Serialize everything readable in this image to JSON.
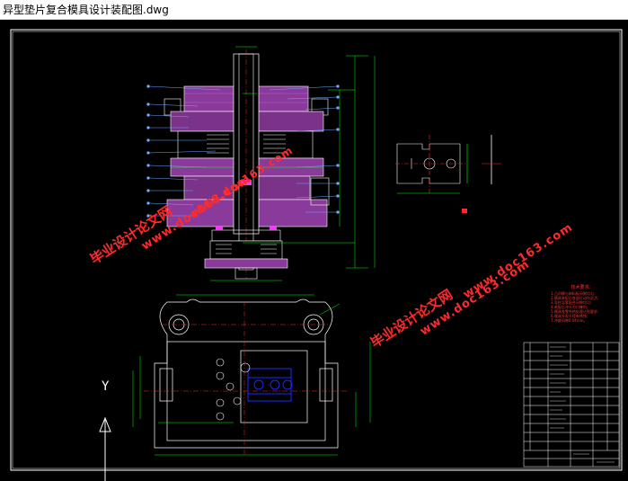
{
  "window": {
    "title": "异型垫片复合模具设计装配图.dwg"
  },
  "watermarks": [
    {
      "text": "毕业设计论文网"
    },
    {
      "text": "www.doc163.com"
    },
    {
      "text": "www.doc163.com"
    },
    {
      "text": "毕业设计论文网"
    },
    {
      "text": "www.doc163.com"
    },
    {
      "text": "www.doc163.com"
    }
  ],
  "ucs": {
    "y_label": "Y"
  },
  "notes": {
    "heading": "技术要求：",
    "lines": [
      "1.凸凹模与卸料板间隙均匀;",
      "2.模具装配后各部位动作灵活;",
      "3.导柱导套配合间隙均匀;",
      "4.装配后冲头刃口锋利;",
      "5.模具各零件热处理达到要求;",
      "6.模具外观不得有锈蚀;",
      "7.冲裁间隙0.04mm。"
    ]
  },
  "colors": {
    "background": "#000000",
    "frame": "#ffffff",
    "die_fill": "#8a3a9a",
    "dimension": "#00ff00",
    "leader": "#6fa8ff",
    "centerline": "#ff2a2a",
    "blue_part": "#1a2aff",
    "watermark": "#ff2a2a"
  }
}
